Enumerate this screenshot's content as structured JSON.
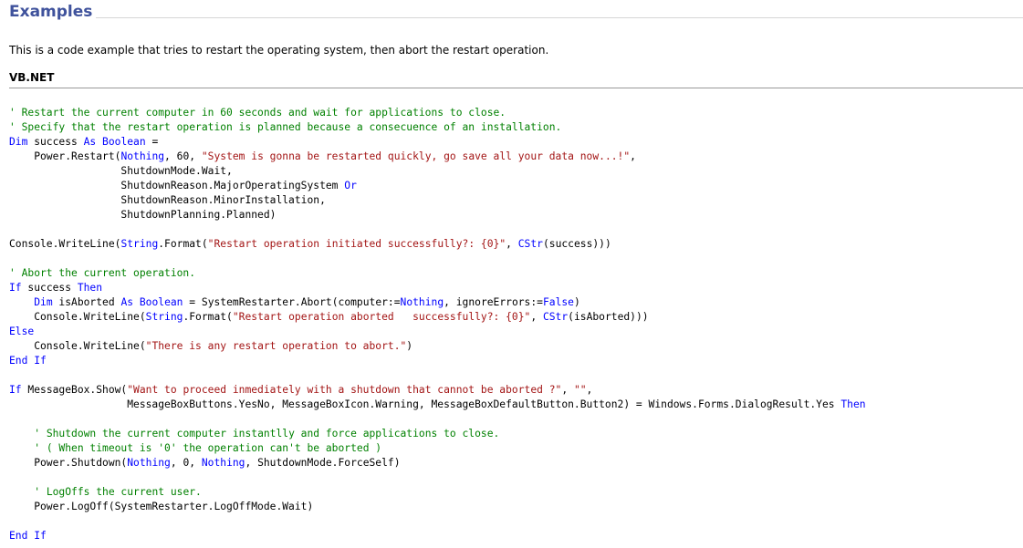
{
  "section": {
    "title": "Examples"
  },
  "intro": {
    "text": "This is a code example that tries to restart the operating system, then abort the restart operation."
  },
  "code_block": {
    "language_label": "VB.NET",
    "colors": {
      "comment": "#008000",
      "keyword": "#0000ff",
      "string": "#a31515",
      "plain": "#000000"
    },
    "lines": [
      [
        {
          "k": "comment",
          "t": "' Restart the current computer in 60 seconds and wait for applications to close."
        }
      ],
      [
        {
          "k": "comment",
          "t": "' Specify that the restart operation is planned because a consecuence of an installation."
        }
      ],
      [
        {
          "k": "keyword",
          "t": "Dim"
        },
        {
          "k": "plain",
          "t": " success "
        },
        {
          "k": "keyword",
          "t": "As"
        },
        {
          "k": "plain",
          "t": " "
        },
        {
          "k": "keyword",
          "t": "Boolean"
        },
        {
          "k": "plain",
          "t": " ="
        }
      ],
      [
        {
          "k": "plain",
          "t": "    Power.Restart("
        },
        {
          "k": "keyword",
          "t": "Nothing"
        },
        {
          "k": "plain",
          "t": ", 60, "
        },
        {
          "k": "string",
          "t": "\"System is gonna be restarted quickly, go save all your data now...!\""
        },
        {
          "k": "plain",
          "t": ","
        }
      ],
      [
        {
          "k": "plain",
          "t": "                  ShutdownMode.Wait,"
        }
      ],
      [
        {
          "k": "plain",
          "t": "                  ShutdownReason.MajorOperatingSystem "
        },
        {
          "k": "keyword",
          "t": "Or"
        }
      ],
      [
        {
          "k": "plain",
          "t": "                  ShutdownReason.MinorInstallation,"
        }
      ],
      [
        {
          "k": "plain",
          "t": "                  ShutdownPlanning.Planned)"
        }
      ],
      [],
      [
        {
          "k": "plain",
          "t": "Console.WriteLine("
        },
        {
          "k": "keyword",
          "t": "String"
        },
        {
          "k": "plain",
          "t": ".Format("
        },
        {
          "k": "string",
          "t": "\"Restart operation initiated successfully?: {0}\""
        },
        {
          "k": "plain",
          "t": ", "
        },
        {
          "k": "keyword",
          "t": "CStr"
        },
        {
          "k": "plain",
          "t": "(success)))"
        }
      ],
      [],
      [
        {
          "k": "comment",
          "t": "' Abort the current operation."
        }
      ],
      [
        {
          "k": "keyword",
          "t": "If"
        },
        {
          "k": "plain",
          "t": " success "
        },
        {
          "k": "keyword",
          "t": "Then"
        }
      ],
      [
        {
          "k": "plain",
          "t": "    "
        },
        {
          "k": "keyword",
          "t": "Dim"
        },
        {
          "k": "plain",
          "t": " isAborted "
        },
        {
          "k": "keyword",
          "t": "As"
        },
        {
          "k": "plain",
          "t": " "
        },
        {
          "k": "keyword",
          "t": "Boolean"
        },
        {
          "k": "plain",
          "t": " = SystemRestarter.Abort(computer:="
        },
        {
          "k": "keyword",
          "t": "Nothing"
        },
        {
          "k": "plain",
          "t": ", ignoreErrors:="
        },
        {
          "k": "keyword",
          "t": "False"
        },
        {
          "k": "plain",
          "t": ")"
        }
      ],
      [
        {
          "k": "plain",
          "t": "    Console.WriteLine("
        },
        {
          "k": "keyword",
          "t": "String"
        },
        {
          "k": "plain",
          "t": ".Format("
        },
        {
          "k": "string",
          "t": "\"Restart operation aborted   successfully?: {0}\""
        },
        {
          "k": "plain",
          "t": ", "
        },
        {
          "k": "keyword",
          "t": "CStr"
        },
        {
          "k": "plain",
          "t": "(isAborted)))"
        }
      ],
      [
        {
          "k": "keyword",
          "t": "Else"
        }
      ],
      [
        {
          "k": "plain",
          "t": "    Console.WriteLine("
        },
        {
          "k": "string",
          "t": "\"There is any restart operation to abort.\""
        },
        {
          "k": "plain",
          "t": ")"
        }
      ],
      [
        {
          "k": "keyword",
          "t": "End"
        },
        {
          "k": "plain",
          "t": " "
        },
        {
          "k": "keyword",
          "t": "If"
        }
      ],
      [],
      [
        {
          "k": "keyword",
          "t": "If"
        },
        {
          "k": "plain",
          "t": " MessageBox.Show("
        },
        {
          "k": "string",
          "t": "\"Want to proceed inmediately with a shutdown that cannot be aborted ?\""
        },
        {
          "k": "plain",
          "t": ", "
        },
        {
          "k": "string",
          "t": "\"\""
        },
        {
          "k": "plain",
          "t": ","
        }
      ],
      [
        {
          "k": "plain",
          "t": "                   MessageBoxButtons.YesNo, MessageBoxIcon.Warning, MessageBoxDefaultButton.Button2) = Windows.Forms.DialogResult.Yes "
        },
        {
          "k": "keyword",
          "t": "Then"
        }
      ],
      [],
      [
        {
          "k": "plain",
          "t": "    "
        },
        {
          "k": "comment",
          "t": "' Shutdown the current computer instantlly and force applications to close."
        }
      ],
      [
        {
          "k": "plain",
          "t": "    "
        },
        {
          "k": "comment",
          "t": "' ( When timeout is '0' the operation can't be aborted )"
        }
      ],
      [
        {
          "k": "plain",
          "t": "    Power.Shutdown("
        },
        {
          "k": "keyword",
          "t": "Nothing"
        },
        {
          "k": "plain",
          "t": ", 0, "
        },
        {
          "k": "keyword",
          "t": "Nothing"
        },
        {
          "k": "plain",
          "t": ", ShutdownMode.ForceSelf)"
        }
      ],
      [],
      [
        {
          "k": "plain",
          "t": "    "
        },
        {
          "k": "comment",
          "t": "' LogOffs the current user."
        }
      ],
      [
        {
          "k": "plain",
          "t": "    Power.LogOff(SystemRestarter.LogOffMode.Wait)"
        }
      ],
      [],
      [
        {
          "k": "keyword",
          "t": "End"
        },
        {
          "k": "plain",
          "t": " "
        },
        {
          "k": "keyword",
          "t": "If"
        }
      ]
    ]
  }
}
